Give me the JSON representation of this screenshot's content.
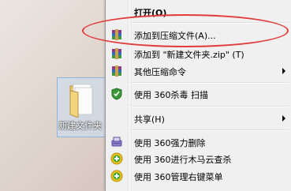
{
  "desktop": {
    "folder_label": "新建文件夹"
  },
  "menu": {
    "open": "打开(O)",
    "add_archive": "添加到压缩文件(A)...",
    "add_zip": "添加到 \"新建文件夹.zip\" (T)",
    "other_compress": "其他压缩命令",
    "scan_360": "使用 360杀毒 扫描",
    "share": "共享(H)",
    "force_delete": "使用 360强力删除",
    "trojan_scan": "使用 360进行木马云查杀",
    "manage_menu": "使用 360管理右键菜单"
  },
  "colors": {
    "highlight_ring": "#e23b3b",
    "menu_bg": "#f0f0f0"
  }
}
